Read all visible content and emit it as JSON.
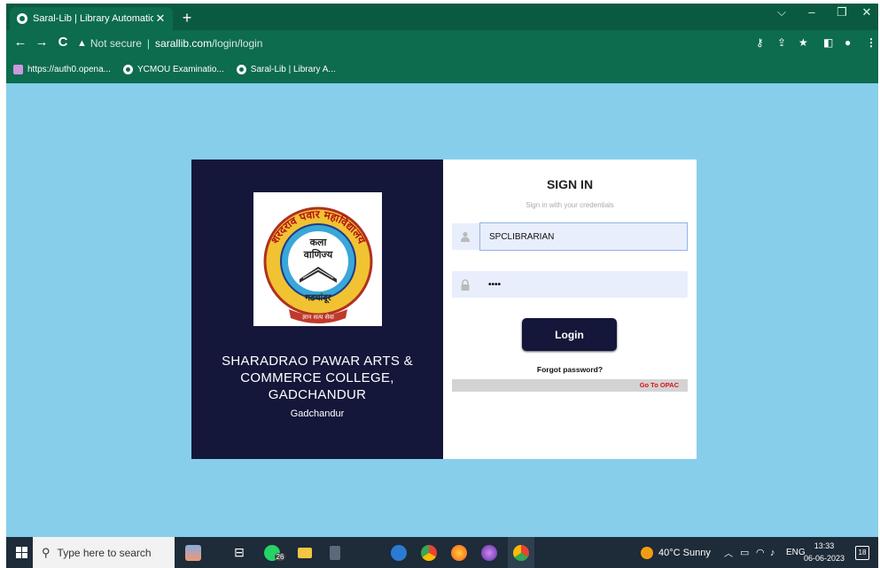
{
  "browser": {
    "tab_title": "Saral-Lib | Library Automation Sy",
    "address_secure": "Not secure",
    "address_host": "sarallib.com",
    "address_path": "/login/login",
    "bookmarks": [
      {
        "label": "https://auth0.opena...",
        "icon": "generic-favicon"
      },
      {
        "label": "YCMOU Examinatio...",
        "icon": "globe-favicon"
      },
      {
        "label": "Saral-Lib | Library A...",
        "icon": "globe-favicon"
      }
    ]
  },
  "login": {
    "institution_lines": [
      "SHARADRAO PAWAR ARTS &",
      "COMMERCE COLLEGE,",
      "GADCHANDUR"
    ],
    "city": "Gadchandur",
    "logo_texts": [
      "शरदराव पवार महाविद्यालय",
      "कला",
      "वाणिज्य",
      "गडचांदूर",
      "ज्ञान सत्य सेवा"
    ],
    "heading": "SIGN IN",
    "subheading": "Sign in with your credentials",
    "username_value": "SPCLIBRARIAN",
    "password_value": "••••",
    "login_button": "Login",
    "forgot_link": "Forgot password?",
    "opac_link": "Go To OPAC"
  },
  "taskbar": {
    "search_placeholder": "Type here to search",
    "whatsapp_badge": "26",
    "weather": "40°C  Sunny",
    "language": "ENG",
    "time": "13:33",
    "date": "06-06-2023",
    "notification_count": "18"
  },
  "colors": {
    "browser_green": "#0d6b4e",
    "page_bg": "#87ceeb",
    "panel_navy": "#14173a",
    "opac_red": "#dd1111"
  }
}
